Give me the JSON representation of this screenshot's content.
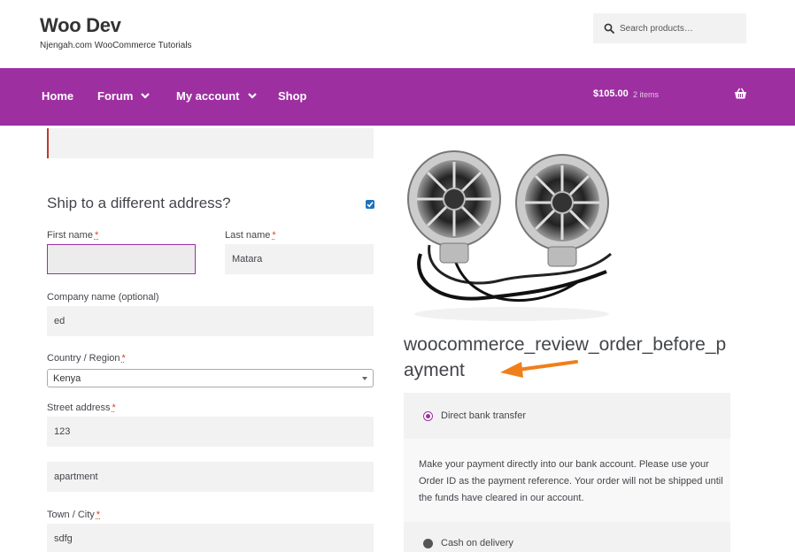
{
  "header": {
    "site_title": "Woo Dev",
    "site_description": "Njengah.com WooCommerce Tutorials",
    "search_placeholder": "Search products…"
  },
  "nav": {
    "items": [
      {
        "label": "Home",
        "has_dropdown": false
      },
      {
        "label": "Forum",
        "has_dropdown": true
      },
      {
        "label": "My account",
        "has_dropdown": true
      },
      {
        "label": "Shop",
        "has_dropdown": false
      }
    ],
    "cart_total": "$105.00",
    "cart_count": "2 items",
    "cart_icon": "basket-icon"
  },
  "colors": {
    "nav_background": "#9e2fa1",
    "required_marker": "#e2401c",
    "annotation_arrow": "#f07f1a"
  },
  "shipping": {
    "heading": "Ship to a different address?",
    "ship_checked": true,
    "first_name_label": "First name",
    "first_name_value": "",
    "last_name_label": "Last name",
    "last_name_value": "Matara",
    "company_label": "Company name (optional)",
    "company_value": "ed",
    "country_label": "Country / Region",
    "country_value": "Kenya",
    "street_label": "Street address",
    "street_value": "123",
    "apartment_value": "apartment",
    "city_label": "Town / City",
    "city_value": "sdfg",
    "required_mark": "*"
  },
  "order_review": {
    "hook_text": "woocommerce_review_order_before_payment",
    "payment_methods": [
      {
        "label": "Direct bank transfer",
        "selected": true
      },
      {
        "label": "Cash on delivery",
        "selected": false
      }
    ],
    "bank_description": "Make your payment directly into our bank account. Please use your Order ID as the payment reference. Your order will not be shipped until the funds have cleared in our account."
  }
}
